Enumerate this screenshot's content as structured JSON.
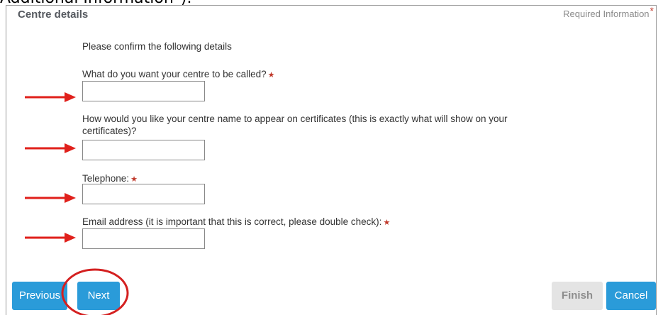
{
  "document": {
    "caption_fragment": "Additional Information\")."
  },
  "panel": {
    "title": "Centre details",
    "required_info": "Required Information",
    "required_star": "*"
  },
  "form": {
    "intro": "Please confirm the following details",
    "fields": [
      {
        "label": "What do you want your centre to be called?",
        "required": true,
        "value": ""
      },
      {
        "label": "How would you like your centre name to appear on certificates (this is exactly what will show on your",
        "label_line2": "certificates)?",
        "required": false,
        "value": ""
      },
      {
        "label": "Telephone:",
        "required": true,
        "value": ""
      },
      {
        "label": "Email address (it is important that this is correct, please double check):",
        "required": true,
        "value": ""
      }
    ],
    "star_glyph": "★"
  },
  "buttons": {
    "previous": "Previous",
    "next": "Next",
    "finish": "Finish",
    "cancel": "Cancel"
  },
  "annotations": {
    "arrow_color": "#e0201b",
    "circle_color": "#d42020",
    "arrow_icon": "right-arrow-icon",
    "circle_highlights": "next-button"
  },
  "colors": {
    "button_blue": "#2a9bd9",
    "button_disabled": "#e4e4e4",
    "required_star": "#c0392b"
  }
}
